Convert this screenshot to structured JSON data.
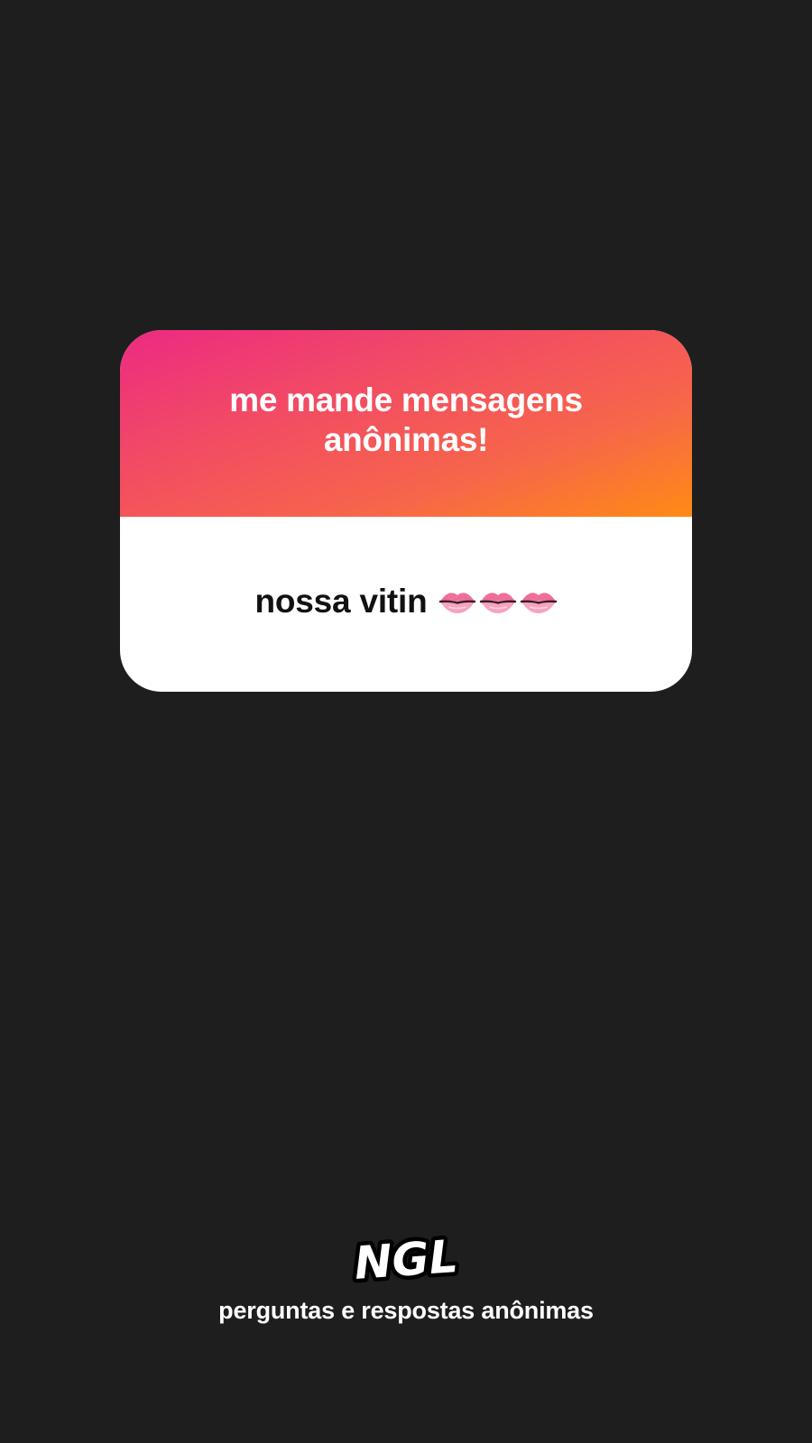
{
  "card": {
    "prompt": "me mande mensagens anônimas!",
    "message": "nossa vitin",
    "emoji": [
      "lips-icon",
      "lips-icon",
      "lips-icon"
    ]
  },
  "brand": {
    "logo_text": "NGL",
    "tagline": "perguntas e respostas anônimas"
  },
  "colors": {
    "background": "#1e1e1e",
    "gradient_start": "#ec2a82",
    "gradient_end": "#fe8b14",
    "card_body": "#ffffff"
  }
}
